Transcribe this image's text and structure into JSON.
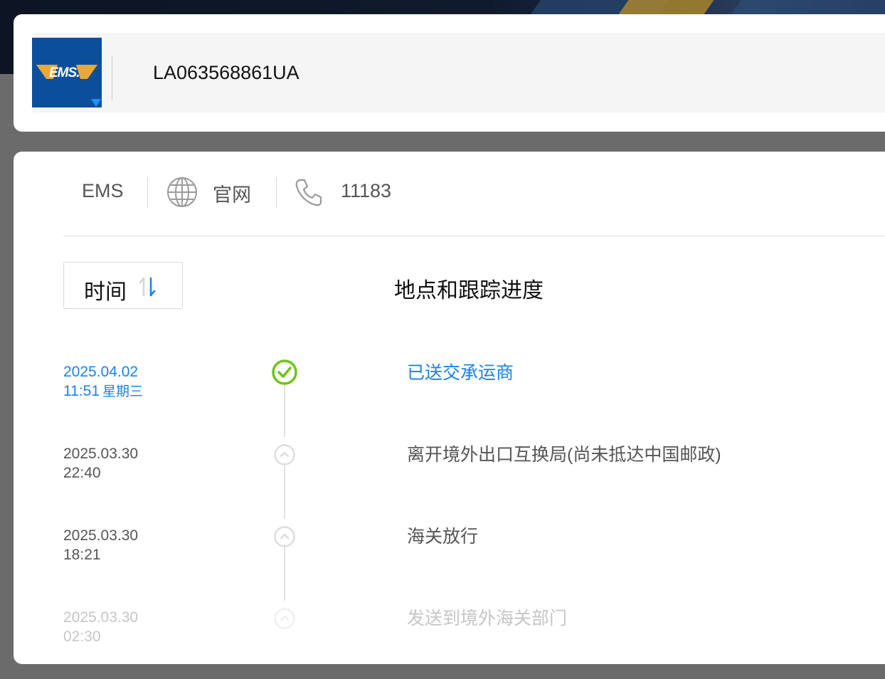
{
  "search": {
    "carrier_logo_text": "EMS.",
    "tracking_number": "LA063568861UA"
  },
  "carrier": {
    "name": "EMS",
    "website_label": "官网",
    "phone": "11183"
  },
  "table": {
    "sort_label": "时间",
    "column_heading": "地点和跟踪进度"
  },
  "events": [
    {
      "date": "2025.04.02",
      "time": "11:51",
      "weekday": "星期三",
      "description": "已送交承运商",
      "status": "latest"
    },
    {
      "date": "2025.03.30",
      "time": "22:40",
      "weekday": "",
      "description": "离开境外出口互换局(尚未抵达中国邮政)",
      "status": "past"
    },
    {
      "date": "2025.03.30",
      "time": "18:21",
      "weekday": "",
      "description": "海关放行",
      "status": "past"
    },
    {
      "date": "2025.03.30",
      "time": "02:30",
      "weekday": "",
      "description": "发送到境外海关部门",
      "status": "faded"
    }
  ],
  "colors": {
    "accent_blue": "#1a82e8",
    "success_green": "#6cc417",
    "text_dark": "#111111",
    "text_gray": "#555555",
    "text_faded": "#c6c6c6"
  },
  "icons": {
    "website": "globe-icon",
    "phone": "phone-icon",
    "sort": "sort-arrows-icon",
    "latest_node": "check-circle-icon",
    "past_node": "chevron-up-circle-icon"
  }
}
